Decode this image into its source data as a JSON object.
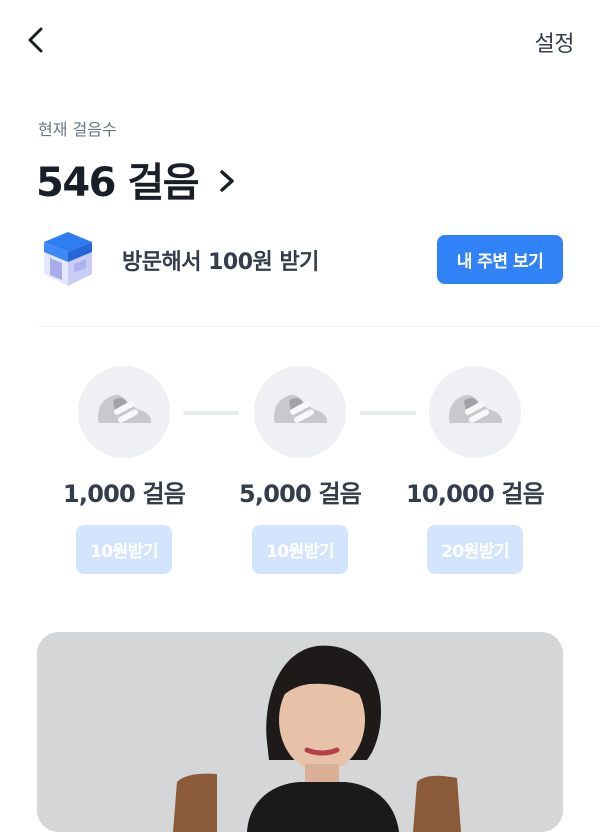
{
  "header": {
    "settings_label": "설정"
  },
  "steps": {
    "label": "현재 걸음수",
    "count_text": "546 걸음"
  },
  "visit": {
    "text": "방문해서 100원 받기",
    "button_label": "내 주변 보기"
  },
  "milestones": [
    {
      "steps_label": "1,000 걸음",
      "reward_label": "10원받기"
    },
    {
      "steps_label": "5,000 걸음",
      "reward_label": "10원받기"
    },
    {
      "steps_label": "10,000 걸음",
      "reward_label": "20원받기"
    }
  ],
  "colors": {
    "primary": "#3182f6",
    "disabled_button": "#d3e5fd"
  }
}
